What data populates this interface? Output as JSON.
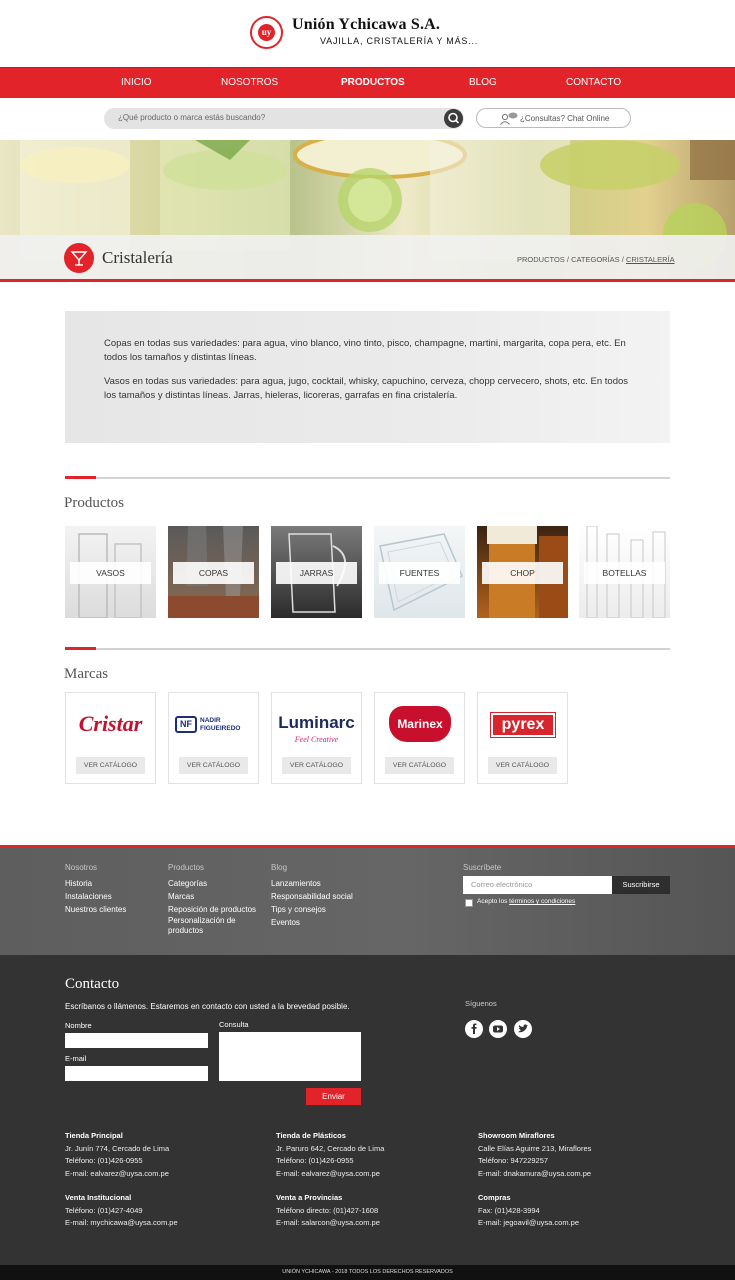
{
  "brand": {
    "name": "Unión Ychicawa S.A.",
    "tagline": "VAJILLA, CRISTALERÍA Y MÁS...",
    "logo_text": "uy",
    "primary_color": "#e3232a"
  },
  "nav": [
    {
      "label": "INICIO"
    },
    {
      "label": "NOSOTROS"
    },
    {
      "label": "PRODUCTOS",
      "active": true
    },
    {
      "label": "BLOG"
    },
    {
      "label": "CONTACTO"
    }
  ],
  "search": {
    "placeholder": "¿Qué producto o marca estás buscando?",
    "icon": "search-icon"
  },
  "chat": {
    "label": "¿Consultas? Chat Online",
    "icon": "chat-user-icon"
  },
  "category": {
    "title": "Cristalería",
    "icon": "cocktail-glass-icon",
    "breadcrumb": [
      "PRODUCTOS",
      "CATEGORÍAS",
      "CRISTALERÍA"
    ]
  },
  "description": [
    "Copas en todas sus variedades: para agua, vino blanco, vino tinto, pisco, champagne, martini, margarita, copa pera, etc. En todos los tamaños y distintas líneas.",
    "Vasos en todas sus variedades: para agua, jugo, cocktail, whisky, capuchino, cerveza, chopp cervecero, shots, etc. En todos los tamaños y distintas líneas. Jarras, hieleras, licoreras, garrafas en fina cristalería."
  ],
  "products_section": {
    "title": "Productos",
    "items": [
      {
        "label": "VASOS"
      },
      {
        "label": "COPAS"
      },
      {
        "label": "JARRAS"
      },
      {
        "label": "FUENTES"
      },
      {
        "label": "CHOP"
      },
      {
        "label": "BOTELLAS"
      }
    ]
  },
  "brands_section": {
    "title": "Marcas",
    "button_label": "VER CATÁLOGO",
    "items": [
      {
        "name": "Cristar",
        "color": "#c8102e"
      },
      {
        "name": "NADIR FIGUEIREDO",
        "mark": "NF",
        "color": "#1d2f7a"
      },
      {
        "name": "Luminarc",
        "sub": "Feel Creative",
        "color": "#1d2a5c",
        "sub_color": "#d6246e"
      },
      {
        "name": "Marinex",
        "color": "#c8102e"
      },
      {
        "name": "pyrex",
        "color": "#d7262e"
      }
    ]
  },
  "footer_links": {
    "nosotros": {
      "title": "Nosotros",
      "items": [
        "Historia",
        "Instalaciones",
        "Nuestros clientes"
      ]
    },
    "productos": {
      "title": "Productos",
      "items": [
        "Categorías",
        "Marcas",
        "Reposición de productos",
        "Personalización de productos"
      ]
    },
    "blog": {
      "title": "Blog",
      "items": [
        "Lanzamientos",
        "Responsabilidad social",
        "Tips y consejos",
        "Eventos"
      ]
    },
    "subscribe": {
      "title": "Suscríbete",
      "placeholder": "Correo electrónico",
      "button": "Suscribirse",
      "accept_prefix": "Acepto los",
      "accept_link": "términos y condiciones"
    }
  },
  "contact": {
    "title": "Contacto",
    "intro": "Escríbanos o llámenos. Estaremos en contacto con usted a la brevedad posible.",
    "name_label": "Nombre",
    "email_label": "E-mail",
    "message_label": "Consulta",
    "send_label": "Enviar",
    "follow_label": "Síguenos",
    "social": [
      "facebook-icon",
      "youtube-icon",
      "twitter-icon"
    ]
  },
  "offices": [
    {
      "title": "Tienda Principal",
      "lines": [
        "Jr. Junín 774, Cercado de Lima",
        "Teléfono: (01)426-0955",
        "E-mail: ealvarez@uysa.com.pe"
      ]
    },
    {
      "title": "Tienda de Plásticos",
      "lines": [
        "Jr. Paruro 642, Cercado de Lima",
        "Teléfono: (01)426-0955",
        "E-mail: ealvarez@uysa.com.pe"
      ]
    },
    {
      "title": "Showroom Miraflores",
      "lines": [
        "Calle Elías Aguirre 213, Miraflores",
        "Teléfono: 947229257",
        "E-mail: dnakamura@uysa.com.pe"
      ]
    },
    {
      "title": "Venta Institucional",
      "lines": [
        "Teléfono: (01)427-4049",
        "E-mail: mychicawa@uysa.com.pe"
      ]
    },
    {
      "title": "Venta a Provincias",
      "lines": [
        "Teléfono directo: (01)427-1608",
        "E-mail: salarcon@uysa.com.pe"
      ]
    },
    {
      "title": "Compras",
      "lines": [
        "Fax: (01)428-3994",
        "E-mail: jegoavil@uysa.com.pe"
      ]
    }
  ],
  "copyright": "UNIÓN YCHICAWA - 2018 TODOS LOS DERECHOS RESERVADOS"
}
